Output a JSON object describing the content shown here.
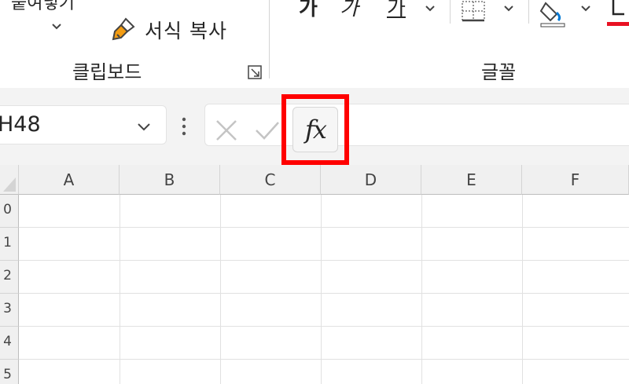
{
  "ribbon": {
    "clipboard": {
      "paste_label": "붙여넣기",
      "format_painter_label": "서식 복사",
      "group_label": "클립보드"
    },
    "font": {
      "group_label": "글꼴",
      "bold_label": "가",
      "italic_label": "가",
      "underline_label": "가",
      "font_color_accent": "#e81123"
    }
  },
  "formula_bar": {
    "name_box_value": "H48",
    "formula_value": "",
    "fx_label": "fx"
  },
  "sheet": {
    "columns": [
      "A",
      "B",
      "C",
      "D",
      "E",
      "F"
    ],
    "row_numbers": [
      "0",
      "1",
      "2",
      "3",
      "4",
      "5"
    ]
  },
  "highlight_color": "#ff0000"
}
